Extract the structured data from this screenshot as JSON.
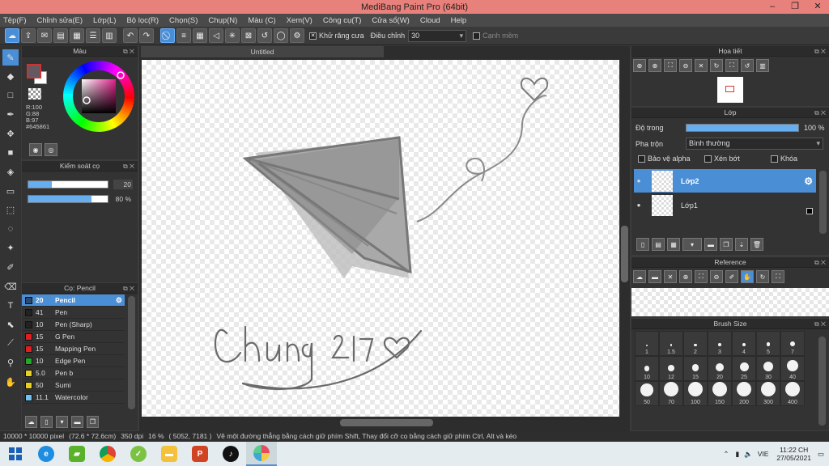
{
  "window": {
    "title": "MediBang Paint Pro (64bit)",
    "controls": [
      "–",
      "❐",
      "✕"
    ]
  },
  "menu": [
    "Tệp(F)",
    "Chỉnh sửa(E)",
    "Lớp(L)",
    "Bộ lọc(R)",
    "Chọn(S)",
    "Chụp(N)",
    "Màu (C)",
    "Xem(V)",
    "Công cụ(T)",
    "Cửa sổ(W)",
    "Cloud",
    "Help"
  ],
  "toolbar": {
    "antialias_label": "Khử răng cưa",
    "adjust_label": "Điều chỉnh",
    "adjust_value": "30",
    "edge_label": "Cạnh mềm"
  },
  "color_panel": {
    "title": "Màu",
    "r": "R:100",
    "g": "G:88",
    "b": "B:97",
    "hex": "#645861",
    "fg_color": "#645861"
  },
  "brush_control": {
    "title": "Kiểm soát cọ",
    "size_value": "20",
    "opacity_value": "80 %",
    "size_fraction": 0.3,
    "opacity_fraction": 0.8
  },
  "brush_panel": {
    "title": "Cọ: Pencil",
    "brushes": [
      {
        "size": "20",
        "name": "Pencil",
        "color": "#2a4a70"
      },
      {
        "size": "41",
        "name": "Pen",
        "color": "#222222"
      },
      {
        "size": "10",
        "name": "Pen (Sharp)",
        "color": "#222222"
      },
      {
        "size": "15",
        "name": "G Pen",
        "color": "#e02020"
      },
      {
        "size": "15",
        "name": "Mapping Pen",
        "color": "#e02020"
      },
      {
        "size": "10",
        "name": "Edge Pen",
        "color": "#22aa22"
      },
      {
        "size": "5.0",
        "name": "Pen b",
        "color": "#e8d020"
      },
      {
        "size": "50",
        "name": "Sumi",
        "color": "#e8d020"
      },
      {
        "size": "11.1",
        "name": "Watercolor",
        "color": "#70c0f0"
      }
    ]
  },
  "canvas": {
    "tab_title": "Untitled"
  },
  "navigator": {
    "title": "Họa tiết"
  },
  "layer_panel": {
    "title": "Lớp",
    "opacity_label": "Độ trong",
    "opacity_value": "100 %",
    "opacity_fraction": 1.0,
    "blend_label": "Pha trộn",
    "blend_value": "Bình thường",
    "protect_alpha": "Bảo vệ alpha",
    "clipping": "Xén bớt",
    "lock": "Khóa",
    "layers": [
      {
        "name": "Lớp2"
      },
      {
        "name": "Lớp1"
      }
    ]
  },
  "reference_panel": {
    "title": "Reference"
  },
  "brush_size_panel": {
    "title": "Brush Size",
    "sizes": [
      "1",
      "1.5",
      "2",
      "3",
      "4",
      "5",
      "7",
      "10",
      "12",
      "15",
      "20",
      "25",
      "30",
      "40",
      "50",
      "70",
      "100",
      "150",
      "200",
      "300",
      "400"
    ]
  },
  "status": {
    "canvas_size": "10000 * 10000 pixel",
    "physical": "(72.6 * 72.6cm)",
    "dpi": "350 dpi",
    "zoom": "16 %",
    "coords": "( 5052, 7181 )",
    "hint": "Vẽ một đường thẳng bằng cách giữ phím Shift, Thay đổi cỡ cọ bằng cách giữ phím Ctrl, Alt và kéo"
  },
  "taskbar": {
    "lang": "VIE",
    "time": "11:22 CH",
    "date": "27/05/2021"
  }
}
